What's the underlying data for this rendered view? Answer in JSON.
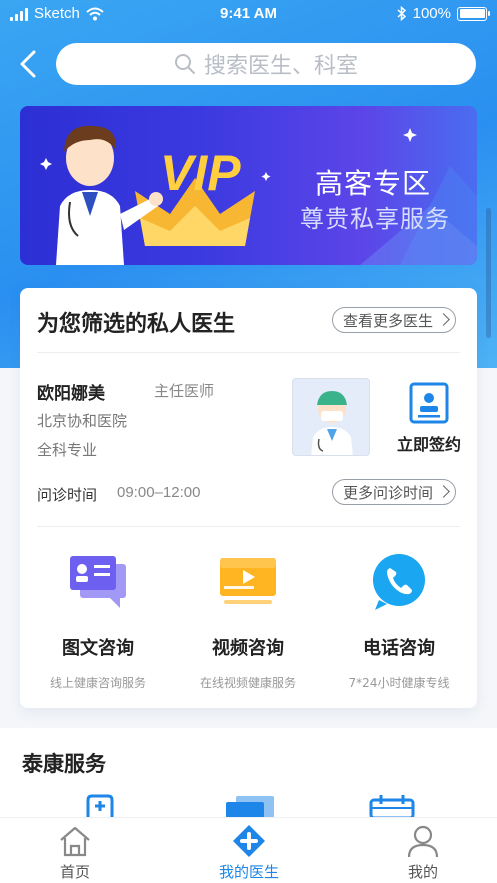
{
  "status_bar": {
    "carrier": "Sketch",
    "time": "9:41 AM",
    "battery": "100%"
  },
  "search": {
    "placeholder": "搜索医生、科室"
  },
  "banner": {
    "badge": "VIP",
    "title": "高客专区",
    "subtitle": "尊贵私享服务"
  },
  "doctor_card": {
    "title": "为您筛选的私人医生",
    "more_doctors": "查看更多医生",
    "doctor": {
      "name": "欧阳娜美",
      "rank": "主任医师",
      "hospital": "北京协和医院",
      "specialty": "全科专业"
    },
    "sign_label": "立即签约",
    "time_label": "问诊时间",
    "time_value": "09:00–12:00",
    "more_times": "更多问诊时间",
    "services": [
      {
        "name": "图文咨询",
        "desc": "线上健康咨询服务",
        "icon": "chat-card-icon"
      },
      {
        "name": "视频咨询",
        "desc": "在线视频健康服务",
        "icon": "video-play-icon"
      },
      {
        "name": "电话咨询",
        "desc": "7*24小时健康专线",
        "icon": "phone-icon"
      }
    ]
  },
  "section2": {
    "title": "泰康服务"
  },
  "tabbar": {
    "tabs": [
      {
        "label": "首页",
        "icon": "home-icon",
        "active": false
      },
      {
        "label": "我的医生",
        "icon": "medical-cross-icon",
        "active": true
      },
      {
        "label": "我的",
        "icon": "user-icon",
        "active": false
      }
    ]
  },
  "colors": {
    "accent": "#1e86e8",
    "banner": "#3b3ae0",
    "hero": "#2a8ff0"
  }
}
